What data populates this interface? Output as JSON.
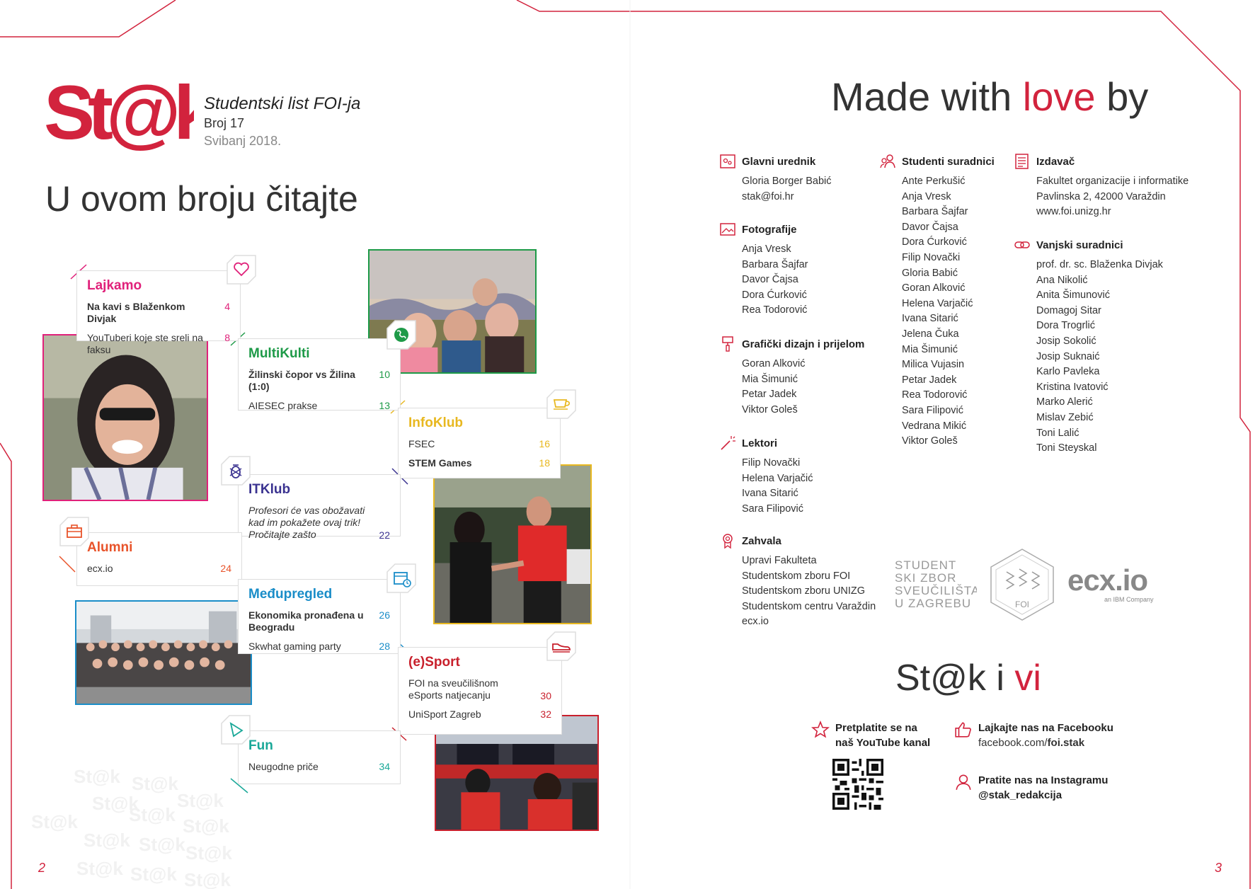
{
  "masthead": {
    "logo_text": "St@k",
    "publication": "Studentski list FOI-ja",
    "issue": "Broj 17",
    "date": "Svibanj 2018."
  },
  "toc_title": "U ovom broju čitajte",
  "sections": [
    {
      "id": "lajkamo",
      "title": "Lajkamo",
      "color": "#e0217a",
      "icon": "heart-icon",
      "items": [
        {
          "text": "Na kavi s Blaženkom Divjak",
          "page": "4",
          "bold": true
        },
        {
          "text": "YouTuberi koje ste sreli na faksu",
          "page": "8"
        }
      ]
    },
    {
      "id": "multikulti",
      "title": "MultiKulti",
      "color": "#1e9a48",
      "icon": "globe-icon",
      "items": [
        {
          "text": "Žilinski čopor vs Žilina (1:0)",
          "page": "10",
          "bold": true
        },
        {
          "text": "AIESEC prakse",
          "page": "13"
        }
      ]
    },
    {
      "id": "infoklub",
      "title": "InfoKlub",
      "color": "#e8b820",
      "icon": "coffee-cup-icon",
      "items": [
        {
          "text": "FSEC",
          "page": "16"
        },
        {
          "text": "STEM Games",
          "page": "18",
          "bold": true
        }
      ]
    },
    {
      "id": "itklub",
      "title": "ITKlub",
      "color": "#3a3290",
      "icon": "bug-icon",
      "items": [
        {
          "text": "Profesori će vas obožavati kad im pokažete ovaj trik! Pročitajte zašto",
          "page": "22",
          "italic": true
        }
      ]
    },
    {
      "id": "alumni",
      "title": "Alumni",
      "color": "#e8532a",
      "icon": "briefcase-icon",
      "items": [
        {
          "text": "ecx.io",
          "page": "24"
        }
      ]
    },
    {
      "id": "medupregled",
      "title": "Međupregled",
      "color": "#1a8dc8",
      "icon": "calendar-clock-icon",
      "items": [
        {
          "text": "Ekonomika pronađena u Beogradu",
          "page": "26",
          "bold": true
        },
        {
          "text": "Skwhat gaming party",
          "page": "28"
        }
      ]
    },
    {
      "id": "esport",
      "title": "(e)Sport",
      "color": "#c8202c",
      "icon": "sneaker-icon",
      "items": [
        {
          "text": "FOI na sveučilišnom eSports natjecanju",
          "page": "30"
        },
        {
          "text": "UniSport Zagreb",
          "page": "32"
        }
      ]
    },
    {
      "id": "fun",
      "title": "Fun",
      "color": "#1aa898",
      "icon": "play-shape-icon",
      "items": [
        {
          "text": "Neugodne priče",
          "page": "34"
        }
      ]
    }
  ],
  "page_numbers": {
    "left": "2",
    "right": "3"
  },
  "credits_heading": {
    "pre": "Made with ",
    "love": "love",
    "post": " by"
  },
  "credits": {
    "glavni_urednik": {
      "title": "Glavni urednik",
      "lines": [
        "Gloria Borger Babić",
        "stak@foi.hr"
      ]
    },
    "fotografije": {
      "title": "Fotografije",
      "lines": [
        "Anja Vresk",
        "Barbara Šajfar",
        "Davor Čajsa",
        "Dora Ćurković",
        "Rea Todorović"
      ]
    },
    "graficki": {
      "title": "Grafički dizajn i prijelom",
      "lines": [
        "Goran Alković",
        "Mia Šimunić",
        "Petar Jadek",
        "Viktor Goleš"
      ]
    },
    "lektori": {
      "title": "Lektori",
      "lines": [
        "Filip Novački",
        "Helena Varjačić",
        "Ivana Sitarić",
        "Sara Filipović"
      ]
    },
    "zahvala": {
      "title": "Zahvala",
      "lines": [
        "Upravi Fakulteta",
        "Studentskom zboru FOI",
        "Studentskom zboru UNIZG",
        "Studentskom centru Varaždin",
        "ecx.io"
      ]
    },
    "studenti": {
      "title": "Studenti suradnici",
      "lines": [
        "Ante Perkušić",
        "Anja Vresk",
        "Barbara Šajfar",
        "Davor Čajsa",
        "Dora Ćurković",
        "Filip Novački",
        "Gloria Babić",
        "Goran Alković",
        "Helena Varjačić",
        "Ivana Sitarić",
        "Jelena Čuka",
        "Mia Šimunić",
        "Milica Vujasin",
        "Petar Jadek",
        "Rea Todorović",
        "Sara Filipović",
        "Vedrana Mikić",
        "Viktor Goleš"
      ]
    },
    "izdavac": {
      "title": "Izdavač",
      "lines": [
        "Fakultet organizacije i informatike",
        "Pavlinska 2, 42000 Varaždin",
        "www.foi.unizg.hr"
      ]
    },
    "vanjski": {
      "title": "Vanjski suradnici",
      "lines": [
        "prof. dr. sc. Blaženka Divjak",
        "Ana Nikolić",
        "Anita Šimunović",
        "Domagoj Sitar",
        "Dora Trogrlić",
        "Josip Sokolić",
        "Josip Suknaić",
        "Karlo Pavleka",
        "Kristina Ivatović",
        "Marko Alerić",
        "Mislav Zebić",
        "Toni Lalić",
        "Toni Steyskal"
      ]
    }
  },
  "partner_logos": {
    "su_lines": [
      "STUDENT",
      "SKI ZBOR",
      "SVEUČILIŠTA",
      "U ZAGREBU"
    ],
    "foi": "FOI",
    "ecx": "ecx.io",
    "ecx_sub": "an IBM Company"
  },
  "stak_vi": {
    "pre": "St@k i ",
    "vi": "vi"
  },
  "social": {
    "youtube": {
      "label": "Pretplatite se na naš YouTube kanal"
    },
    "facebook": {
      "label": "Lajkajte nas na Facebooku",
      "url_pre": "facebook.com/",
      "url_bold": "foi.stak"
    },
    "instagram": {
      "label": "Pratite nas na Instagramu",
      "handle": "@stak_redakcija"
    }
  },
  "colors": {
    "brand_red": "#d2233d",
    "frame_red": "#d2233d"
  }
}
